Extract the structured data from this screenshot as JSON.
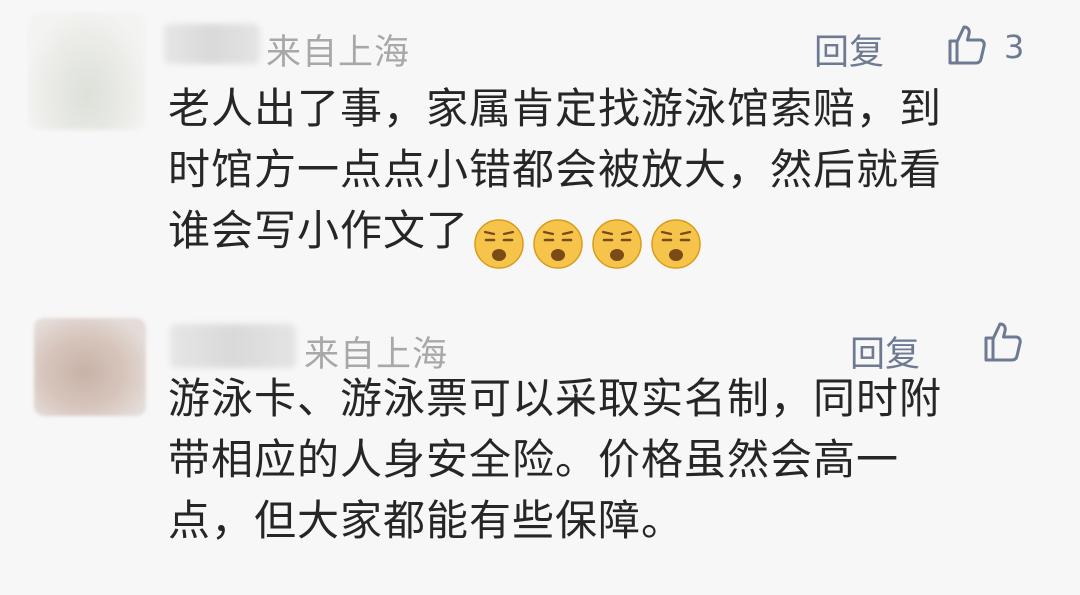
{
  "comments": [
    {
      "location": "来自上海",
      "reply_label": "回复",
      "like_count": "3",
      "lines": [
        "老人出了事，家属肯定找游泳馆索赔，到",
        "时馆方一点点小错都会被放大，然后就看",
        "谁会写小作文了"
      ],
      "emojis": [
        "unamused-face-icon",
        "unamused-face-icon",
        "unamused-face-icon",
        "unamused-face-icon"
      ]
    },
    {
      "location": "来自上海",
      "reply_label": "回复",
      "like_count": "",
      "lines": [
        "游泳卡、游泳票可以采取实名制，同时附",
        "带相应的人身安全险。价格虽然会高一",
        "点，但大家都能有些保障。"
      ]
    }
  ],
  "colors": {
    "background": "#f7f7f7",
    "text": "#262626",
    "meta": "#a8a8a8",
    "action": "#6d7a92",
    "emoji_face": "#f6c44b"
  }
}
